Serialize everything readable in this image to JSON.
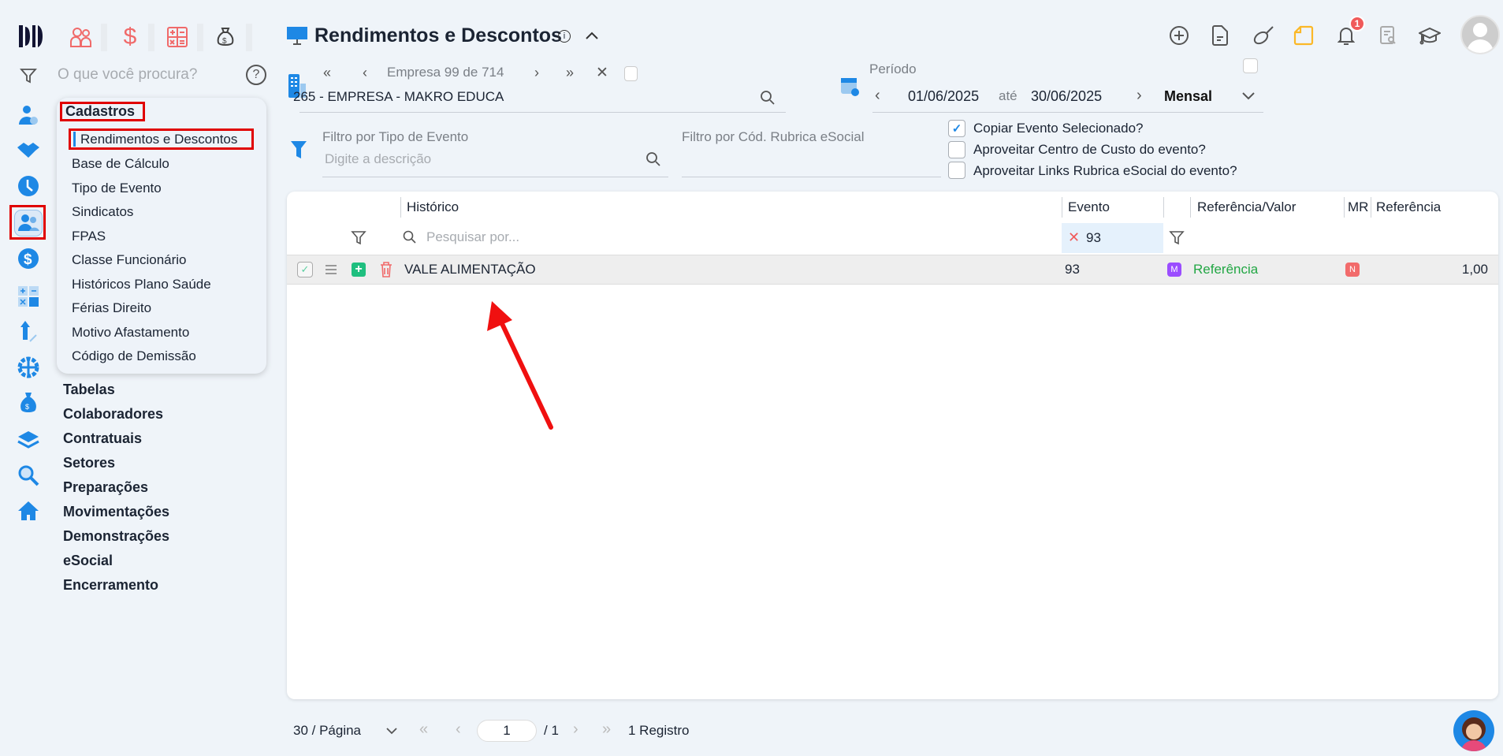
{
  "app": {
    "logo": "M"
  },
  "top_shortcuts": [
    {
      "icon": "people-icon"
    },
    {
      "icon": "dollar-icon"
    },
    {
      "icon": "calculator-icon"
    },
    {
      "icon": "money-bag-icon"
    }
  ],
  "search": {
    "placeholder": "O que você procura?"
  },
  "menu": {
    "open_group": "Cadastros",
    "open_items": [
      "Rendimentos e Descontos",
      "Base de Cálculo",
      "Tipo de Evento",
      "Sindicatos",
      "FPAS",
      "Classe Funcionário",
      "Históricos Plano Saúde",
      "Férias Direito",
      "Motivo Afastamento",
      "Código de Demissão"
    ],
    "groups": [
      "Tabelas",
      "Colaboradores",
      "Contratuais",
      "Setores",
      "Preparações",
      "Movimentações",
      "Demonstrações",
      "eSocial",
      "Encerramento"
    ]
  },
  "header": {
    "title": "Rendimentos e Descontos",
    "notification_count": "1"
  },
  "empresa": {
    "nav_label": "Empresa",
    "current": "99",
    "of_label": "de",
    "total": "714",
    "value": "265 - EMPRESA - MAKRO EDUCA"
  },
  "periodo": {
    "label": "Período",
    "start": "01/06/2025",
    "until_label": "até",
    "end": "30/06/2025",
    "frequency": "Mensal"
  },
  "filters": {
    "tipo_evento_label": "Filtro por Tipo de Evento",
    "tipo_evento_placeholder": "Digite a descrição",
    "rubrica_label": "Filtro por Cód. Rubrica eSocial",
    "rubrica_value": ""
  },
  "options": [
    {
      "label": "Copiar Evento Selecionado?",
      "checked": true
    },
    {
      "label": "Aproveitar Centro de Custo do evento?",
      "checked": false
    },
    {
      "label": "Aproveitar Links Rubrica eSocial do evento?",
      "checked": false
    }
  ],
  "table": {
    "columns": [
      "Histórico",
      "Evento",
      "Referência/Valor",
      "MR",
      "Referência"
    ],
    "search_placeholder": "Pesquisar por...",
    "evento_filter": "93",
    "rows": [
      {
        "historico": "VALE ALIMENTAÇÃO",
        "evento": "93",
        "tipo_badge": "M",
        "ref_valor": "Referência",
        "mr_badge": "N",
        "referencia": "1,00"
      }
    ]
  },
  "pagination": {
    "page_size": "30 / Página",
    "page": "1",
    "total_pages": "/ 1",
    "records": "1 Registro"
  },
  "colors": {
    "accent": "#1e88e5",
    "highlight": "#e00000",
    "green": "#22a744",
    "purple": "#9b4dff",
    "coral": "#f26b6b"
  }
}
